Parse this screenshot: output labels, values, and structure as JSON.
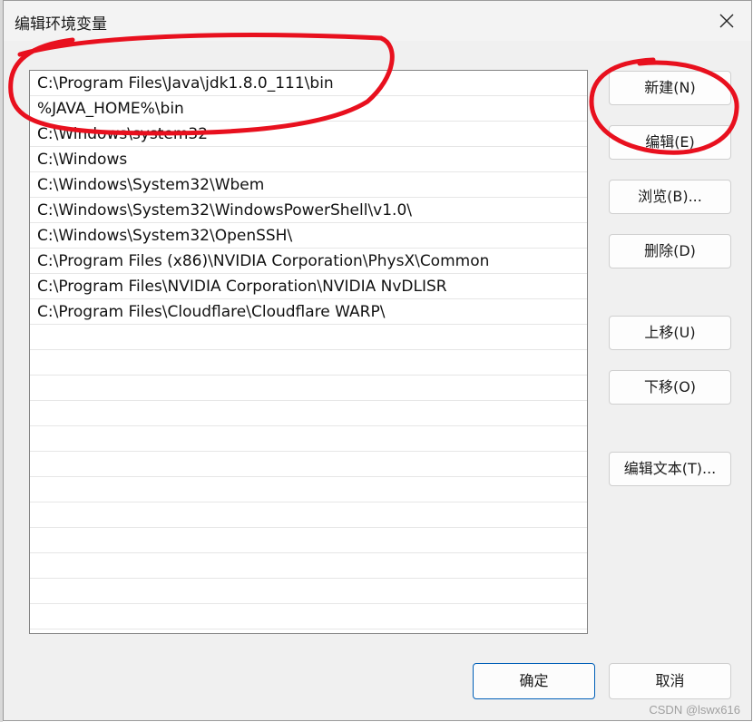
{
  "dialog": {
    "title": "编辑环境变量"
  },
  "path_entries": [
    "C:\\Program Files\\Java\\jdk1.8.0_111\\bin",
    "%JAVA_HOME%\\bin",
    "C:\\Windows\\system32",
    "C:\\Windows",
    "C:\\Windows\\System32\\Wbem",
    "C:\\Windows\\System32\\WindowsPowerShell\\v1.0\\",
    "C:\\Windows\\System32\\OpenSSH\\",
    "C:\\Program Files (x86)\\NVIDIA Corporation\\PhysX\\Common",
    "C:\\Program Files\\NVIDIA Corporation\\NVIDIA NvDLISR",
    "C:\\Program Files\\Cloudflare\\Cloudflare WARP\\"
  ],
  "empty_rows": 12,
  "buttons": {
    "new": "新建(N)",
    "edit": "编辑(E)",
    "browse": "浏览(B)...",
    "delete": "删除(D)",
    "move_up": "上移(U)",
    "move_down": "下移(O)",
    "edit_text": "编辑文本(T)...",
    "ok": "确定",
    "cancel": "取消"
  },
  "watermark": "CSDN @lswx616",
  "colors": {
    "annotation_red": "#e8101e",
    "primary_border": "#005fb8"
  },
  "icons": {
    "close": "close-icon"
  }
}
